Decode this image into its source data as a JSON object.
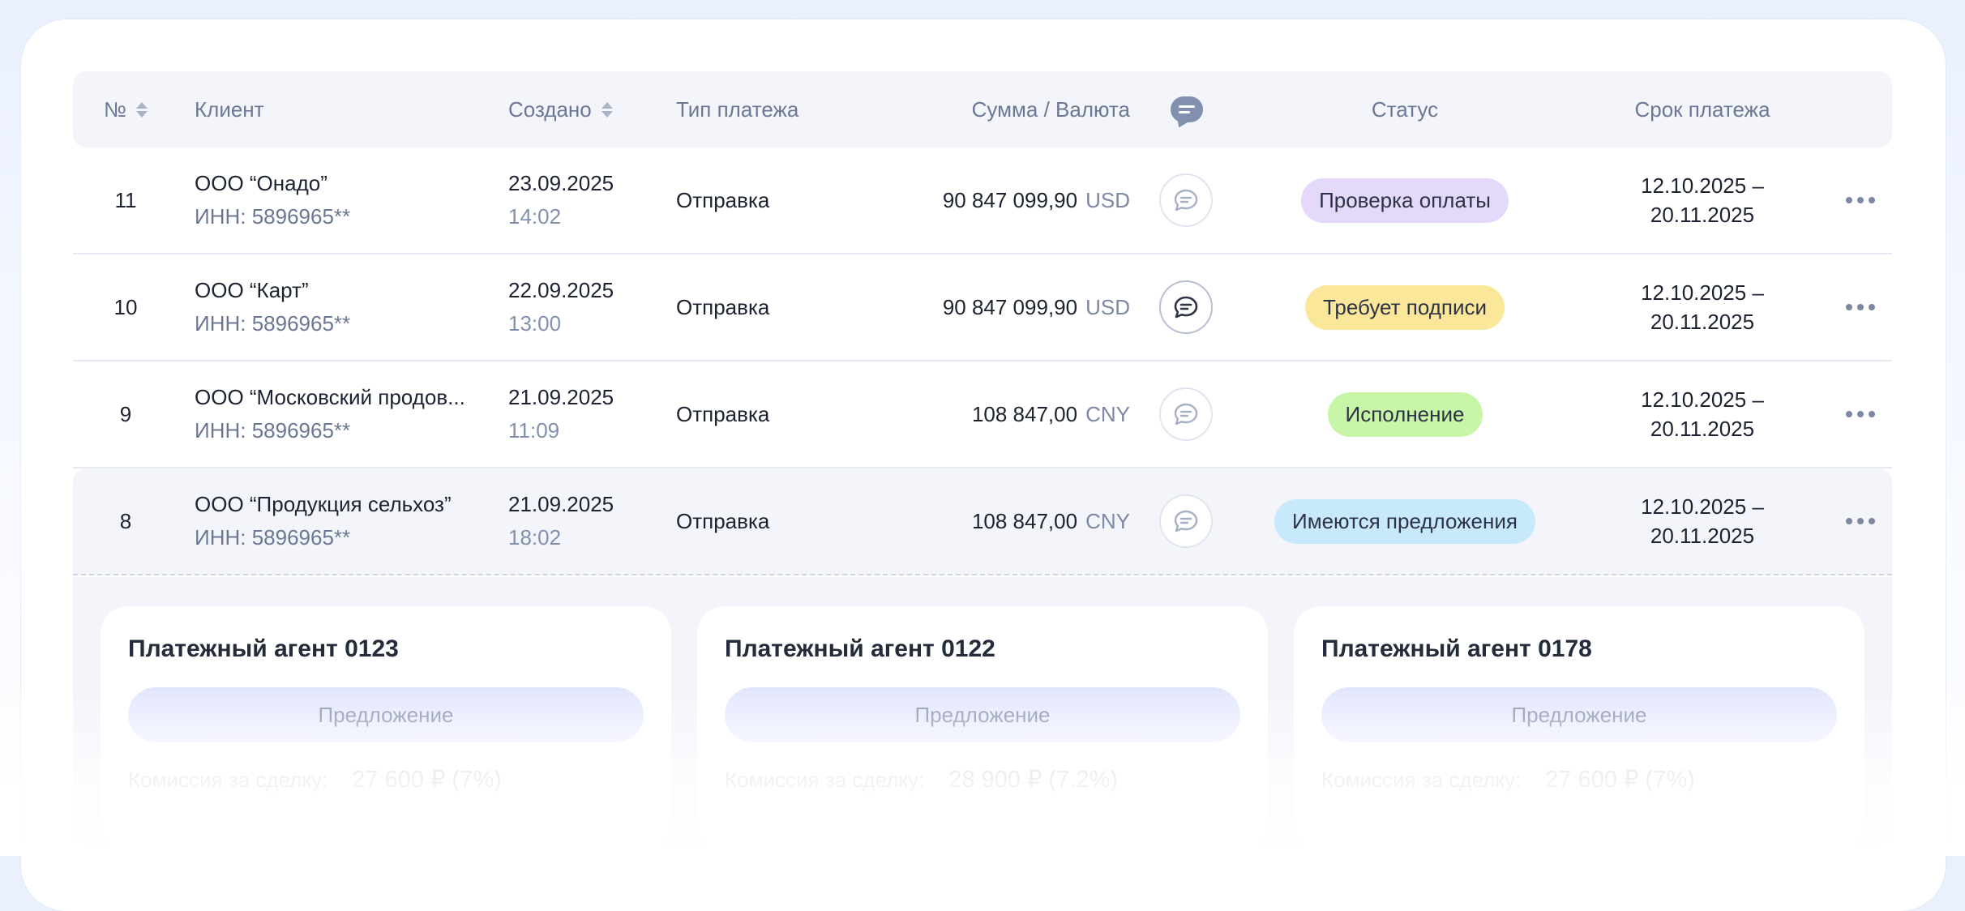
{
  "header": {
    "col_num": "№",
    "col_client": "Клиент",
    "col_created": "Создано",
    "col_type": "Тип платежа",
    "col_amount": "Сумма / Валюта",
    "col_status": "Статус",
    "col_due": "Срок платежа"
  },
  "rows": [
    {
      "num": "11",
      "client": "ООО “Онадо”",
      "inn": "ИНН: 5896965**",
      "date": "23.09.2025",
      "time": "14:02",
      "type": "Отправка",
      "amount": "90 847 099,90",
      "currency": "USD",
      "status": "Проверка оплаты",
      "status_color": "#e5d9fb",
      "due_from": "12.10.2025 –",
      "due_to": "20.11.2025"
    },
    {
      "num": "10",
      "client": "ООО “Карт”",
      "inn": "ИНН: 5896965**",
      "date": "22.09.2025",
      "time": "13:00",
      "type": "Отправка",
      "amount": "90 847 099,90",
      "currency": "USD",
      "status": "Требует подписи",
      "status_color": "#fbe799",
      "due_from": "12.10.2025 –",
      "due_to": "20.11.2025"
    },
    {
      "num": "9",
      "client": "ООО “Московский продов...",
      "inn": "ИНН: 5896965**",
      "date": "21.09.2025",
      "time": "11:09",
      "type": "Отправка",
      "amount": "108 847,00",
      "currency": "CNY",
      "status": "Исполнение",
      "status_color": "#c8f5a8",
      "due_from": "12.10.2025 –",
      "due_to": "20.11.2025"
    },
    {
      "num": "8",
      "client": "ООО “Продукция сельхоз”",
      "inn": "ИНН: 5896965**",
      "date": "21.09.2025",
      "time": "18:02",
      "type": "Отправка",
      "amount": "108 847,00",
      "currency": "CNY",
      "status": "Имеются предложения",
      "status_color": "#c8e8fb",
      "due_from": "12.10.2025 –",
      "due_to": "20.11.2025"
    }
  ],
  "offers": [
    {
      "title": "Платежный агент 0123",
      "button": "Предложение",
      "fee_label": "Комиссия за сделку:",
      "fee_value": "27 600 ₽ (7%)"
    },
    {
      "title": "Платежный агент 0122",
      "button": "Предложение",
      "fee_label": "Комиссия за сделку:",
      "fee_value": "28 900 ₽ (7.2%)"
    },
    {
      "title": "Платежный агент 0178",
      "button": "Предложение",
      "fee_label": "Комиссия за сделку:",
      "fee_value": "27 600 ₽ (7%)"
    }
  ],
  "icons": {
    "sort": "sort-icon",
    "chat": "chat-icon",
    "more": "more-dots-icon"
  }
}
